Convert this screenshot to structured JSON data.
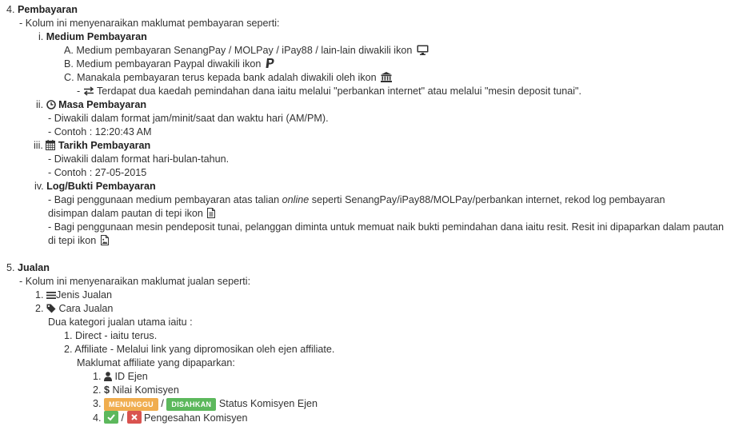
{
  "section4": {
    "num": "4.",
    "title": "Pembayaran",
    "intro": "- Kolum ini menyenaraikan maklumat pembayaran seperti:",
    "medium": {
      "num": "i.",
      "title": "Medium Pembayaran",
      "a_num": "A.",
      "a_text": "Medium pembayaran SenangPay / MOLPay / iPay88 / lain-lain diwakili ikon",
      "b_num": "B.",
      "b_text": "Medium pembayaran Paypal diwakili ikon",
      "c_num": "C.",
      "c_text": "Manakala pembayaran terus kepada bank adalah diwakili oleh ikon",
      "c_sub_prefix": "-",
      "c_sub_text": "Terdapat dua kaedah pemindahan dana iaitu melalui \"perbankan internet\" atau melalui \"mesin deposit tunai\"."
    },
    "masa": {
      "num": "ii.",
      "title": "Masa Pembayaran",
      "desc": "- Diwakili dalam format jam/minit/saat dan waktu hari (AM/PM).",
      "example": "- Contoh : 12:20:43 AM"
    },
    "tarikh": {
      "num": "iii.",
      "title": "Tarikh Pembayaran",
      "desc": "- Diwakili dalam format hari-bulan-tahun.",
      "example": "- Contoh : 27-05-2015"
    },
    "log": {
      "num": "iv.",
      "title": "Log/Bukti Pembayaran",
      "p1_a": "- Bagi penggunaan medium pembayaran atas talian",
      "p1_em": "online",
      "p1_b": "seperti SenangPay/iPay88/MOLPay/perbankan internet, rekod log pembayaran disimpan dalam pautan di tepi ikon",
      "p2": "- Bagi penggunaan mesin pendeposit tunai, pelanggan diminta untuk memuat naik bukti pemindahan dana iaitu resit. Resit ini dipaparkan dalam pautan di tepi ikon"
    }
  },
  "section5": {
    "num": "5.",
    "title": "Jualan",
    "intro": "- Kolum ini menyenaraikan maklumat jualan seperti:",
    "item1_num": "1.",
    "item1_text": "Jenis Jualan",
    "item2_num": "2.",
    "item2_text": "Cara Jualan",
    "kategori": "Dua kategori jualan utama iaitu :",
    "k1_num": "1.",
    "k1_text": "Direct - iaitu terus.",
    "k2_num": "2.",
    "k2_text": "Affiliate - Melalui link yang dipromosikan oleh ejen affiliate.",
    "maklumat": "Maklumat affiliate yang dipaparkan:",
    "m1_num": "1.",
    "m1_text": "ID Ejen",
    "m2_num": "2.",
    "m2_text": "Nilai Komisyen",
    "m3_num": "3.",
    "badge_pending": "MENUNGGU",
    "slash": "/",
    "badge_approved": "DISAHKAN",
    "m3_text": "Status Komisyen Ejen",
    "m4_num": "4.",
    "m4_text": "Pengesahan Komisyen"
  },
  "colors": {
    "pending": "#f0ad4e",
    "approved": "#5cb85c",
    "confirm": "#5cb85c",
    "reject": "#d9534f"
  },
  "icons": [
    "desktop-icon",
    "paypal-icon",
    "bank-icon",
    "exchange-icon",
    "clock-icon",
    "calendar-icon",
    "document-icon",
    "image-file-icon",
    "list-icon",
    "tag-icon",
    "user-icon",
    "dollar-icon",
    "check-icon",
    "times-icon"
  ]
}
